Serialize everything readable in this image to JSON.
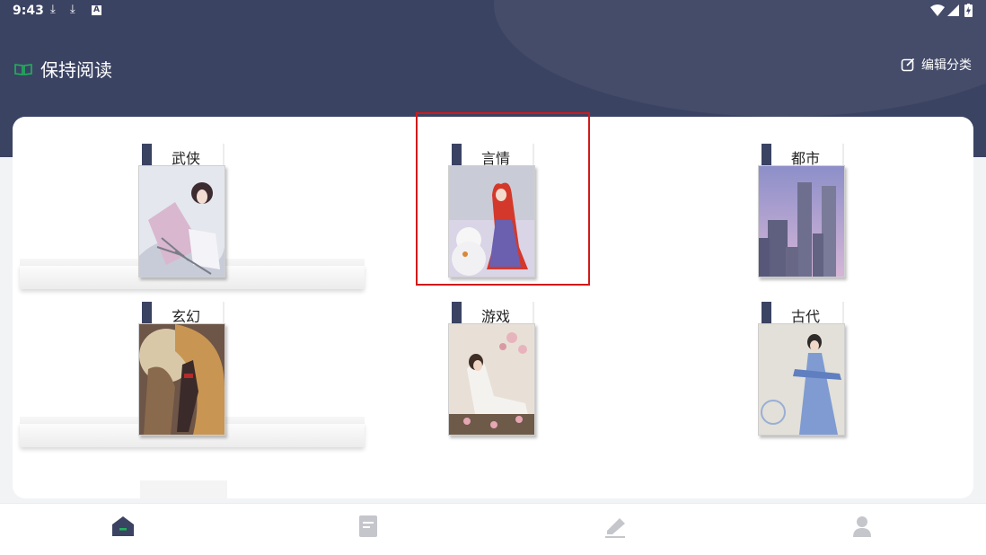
{
  "status_bar": {
    "time": "9:43"
  },
  "header": {
    "title": "保持阅读",
    "edit_label": "编辑分类"
  },
  "categories": [
    {
      "label": "武侠"
    },
    {
      "label": "言情"
    },
    {
      "label": "都市"
    },
    {
      "label": "玄幻"
    },
    {
      "label": "游戏"
    },
    {
      "label": "古代"
    }
  ],
  "colors": {
    "header_bg": "#3b4363",
    "highlight": "#d11a1a",
    "accent_green": "#1fb35a"
  },
  "tab_icons": [
    "home-icon",
    "document-icon",
    "pen-icon",
    "user-icon"
  ]
}
